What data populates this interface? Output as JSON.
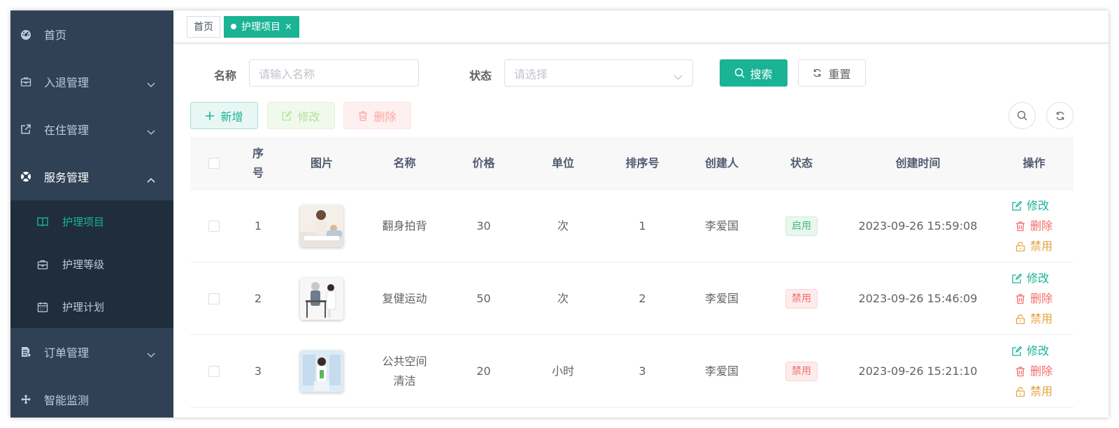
{
  "colors": {
    "accent": "#1ab394",
    "sidebar_bg": "#304156",
    "submenu_bg": "#1f2d3d",
    "danger": "#f56c6c",
    "warning": "#e6a23c",
    "success": "#4cb87d"
  },
  "sidebar": {
    "items": [
      {
        "label": "首页",
        "icon": "dashboard-icon"
      },
      {
        "label": "入退管理",
        "icon": "briefcase-icon"
      },
      {
        "label": "在住管理",
        "icon": "external-link-icon"
      },
      {
        "label": "服务管理",
        "icon": "lifebuoy-icon"
      },
      {
        "label": "订单管理",
        "icon": "document-icon"
      },
      {
        "label": "智能监测",
        "icon": "move-icon"
      }
    ],
    "subitems": [
      {
        "label": "护理项目",
        "icon": "book-icon"
      },
      {
        "label": "护理等级",
        "icon": "briefcase-icon"
      },
      {
        "label": "护理计划",
        "icon": "calendar-icon"
      }
    ]
  },
  "tags": {
    "home": "首页",
    "current": "护理项目",
    "close": "×"
  },
  "search": {
    "name_label": "名称",
    "name_placeholder": "请输入名称",
    "status_label": "状态",
    "status_placeholder": "请选择",
    "search_button": "搜索",
    "reset_button": "重置"
  },
  "toolbar": {
    "add": "新增",
    "edit": "修改",
    "delete": "删除"
  },
  "table": {
    "headers": [
      "序号",
      "图片",
      "名称",
      "价格",
      "单位",
      "排序号",
      "创建人",
      "状态",
      "创建时间",
      "操作"
    ],
    "index_header_line1": "序",
    "index_header_line2": "号",
    "rows": [
      {
        "index": "1",
        "name_line1": "翻身拍背",
        "name_line2": "",
        "price": "30",
        "unit": "次",
        "sort": "1",
        "creator": "李爱国",
        "status": "启用",
        "created": "2023-09-26 15:59:08"
      },
      {
        "index": "2",
        "name_line1": "复健运动",
        "name_line2": "",
        "price": "50",
        "unit": "次",
        "sort": "2",
        "creator": "李爱国",
        "status": "禁用",
        "created": "2023-09-26 15:46:09"
      },
      {
        "index": "3",
        "name_line1": "公共空间",
        "name_line2": "清洁",
        "price": "20",
        "unit": "小时",
        "sort": "3",
        "creator": "李爱国",
        "status": "禁用",
        "created": "2023-09-26 15:21:10"
      }
    ],
    "ops": {
      "edit": "修改",
      "delete": "删除",
      "disable": "禁用"
    }
  }
}
